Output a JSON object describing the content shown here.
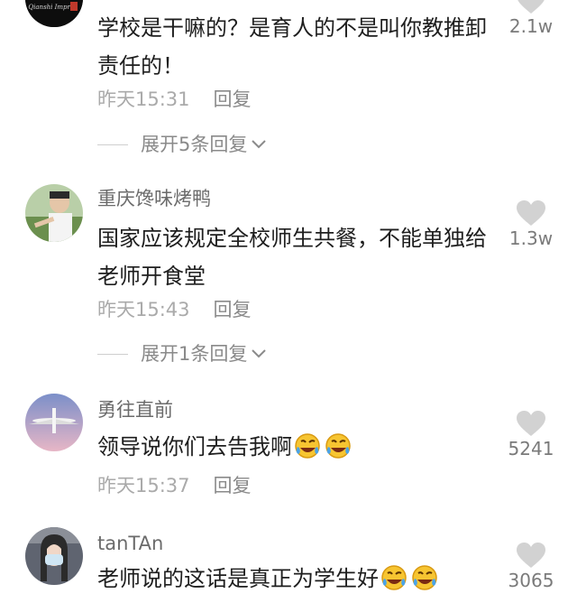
{
  "comments": [
    {
      "username": "",
      "text": "学校是干嘛的？是育人的不是叫你教推卸责任的！",
      "time": "昨天15:31",
      "reply_label": "回复",
      "expand_label": "展开5条回复",
      "likes": "2.1w",
      "avatar_text": "Qianshi Impref"
    },
    {
      "username": "重庆馋味烤鸭",
      "text": "国家应该规定全校师生共餐，不能单独给老师开食堂",
      "time": "昨天15:43",
      "reply_label": "回复",
      "expand_label": "展开1条回复",
      "likes": "1.3w"
    },
    {
      "username": "勇往直前",
      "text": "领导说你们去告我啊",
      "time": "昨天15:37",
      "reply_label": "回复",
      "likes": "5241",
      "emojis": [
        "laugh-cry-emoji",
        "laugh-cry-emoji"
      ]
    },
    {
      "username": "tanTAn",
      "text": "老师说的这话是真正为学生好",
      "likes": "3065",
      "emojis": [
        "laugh-cry-emoji",
        "laugh-cry-emoji"
      ]
    }
  ],
  "colors": {
    "text": "#1e1e1e",
    "muted": "#aaaaaa",
    "heart": "#d2d2d2"
  }
}
